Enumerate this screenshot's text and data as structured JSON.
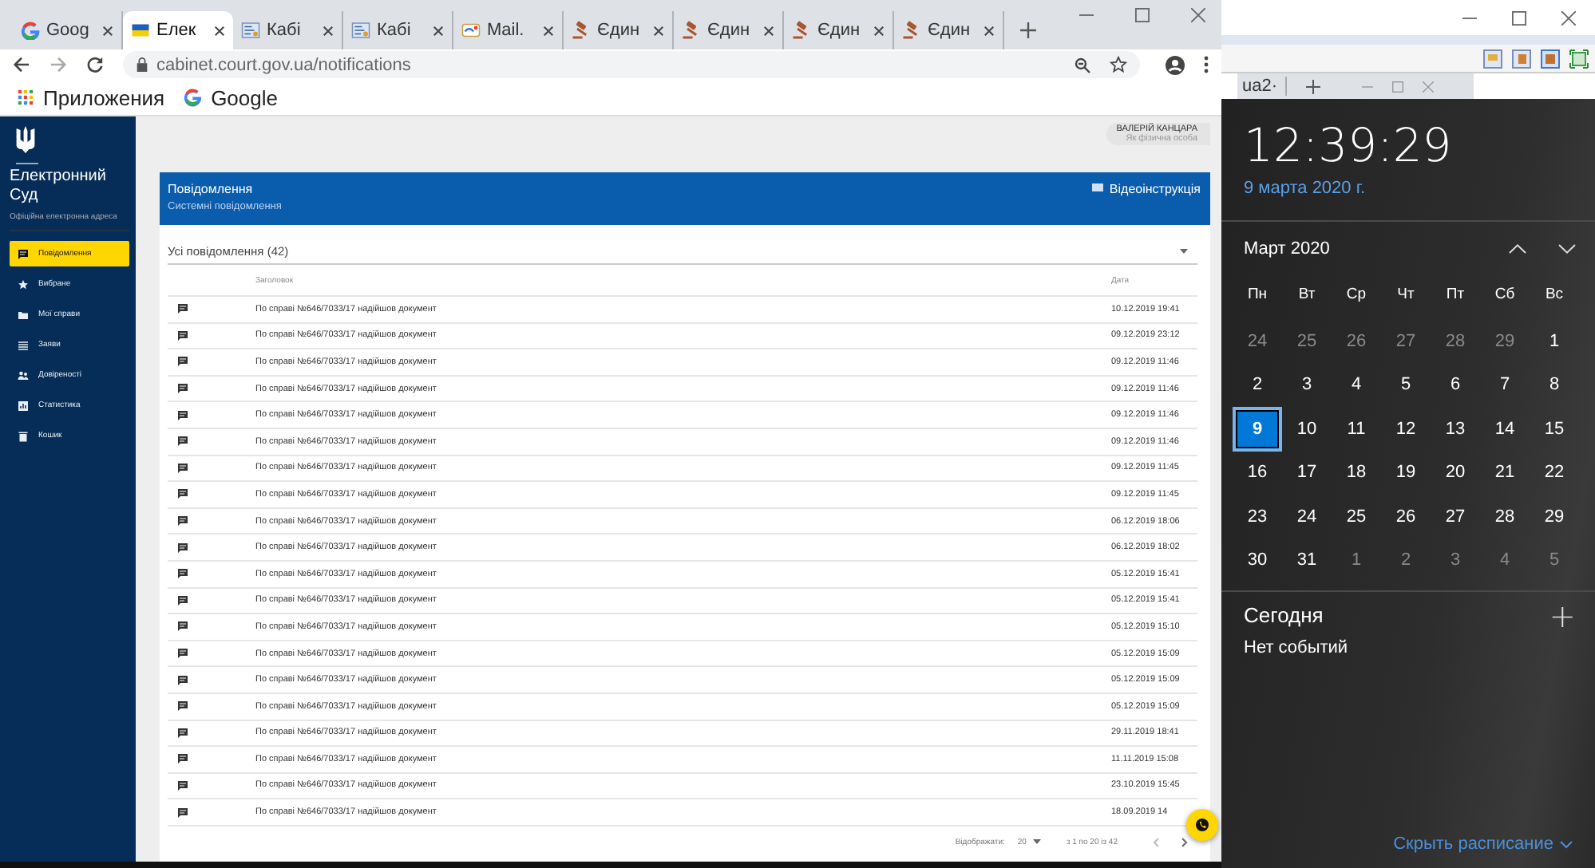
{
  "browser": {
    "tabs": [
      {
        "kind": "google",
        "label": "Goog",
        "selected": false
      },
      {
        "kind": "flag",
        "label": "Елек",
        "selected": true
      },
      {
        "kind": "cabinet",
        "label": "Кабі",
        "selected": false
      },
      {
        "kind": "cabinet",
        "label": "Кабі",
        "selected": false
      },
      {
        "kind": "mail",
        "label": "Mail.",
        "selected": false
      },
      {
        "kind": "gavel",
        "label": "Єдин",
        "selected": false
      },
      {
        "kind": "gavel",
        "label": "Єдин",
        "selected": false
      },
      {
        "kind": "gavel",
        "label": "Єдин",
        "selected": false
      },
      {
        "kind": "gavel",
        "label": "Єдин",
        "selected": false
      }
    ],
    "address": "cabinet.court.gov.ua/notifications",
    "bookmarks": [
      {
        "kind": "apps",
        "label": "Приложения"
      },
      {
        "kind": "google",
        "label": "Google"
      }
    ]
  },
  "app": {
    "brand": "Електронний Суд",
    "brand_subtitle": "Офіційна електронна адреса",
    "sidebar": [
      {
        "kind": "message",
        "label": "Повідомлення",
        "selected": true
      },
      {
        "kind": "star",
        "label": "Вибране",
        "selected": false
      },
      {
        "kind": "folder",
        "label": "Мої справи",
        "selected": false
      },
      {
        "kind": "list",
        "label": "Заяви",
        "selected": false
      },
      {
        "kind": "people",
        "label": "Довіреності",
        "selected": false
      },
      {
        "kind": "chart",
        "label": "Статистика",
        "selected": false
      },
      {
        "kind": "trash",
        "label": "Кошик",
        "selected": false
      }
    ],
    "user": {
      "name": "ВАЛЕРІЙ КАНЦАРА",
      "role": "Як фізична особа"
    },
    "header": {
      "title": "Повідомлення",
      "subtitle": "Системні повідомлення",
      "video_link": "Відеоінструкція"
    },
    "filter": "Усі повідомлення (42)",
    "columns": [
      "Заголовок",
      "Дата"
    ],
    "rows": [
      {
        "title": "По справі №646/7033/17 надійшов документ",
        "date": "10.12.2019 19:41"
      },
      {
        "title": "По справі №646/7033/17 надійшов документ",
        "date": "09.12.2019 23:12"
      },
      {
        "title": "По справі №646/7033/17 надійшов документ",
        "date": "09.12.2019 11:46"
      },
      {
        "title": "По справі №646/7033/17 надійшов документ",
        "date": "09.12.2019 11:46"
      },
      {
        "title": "По справі №646/7033/17 надійшов документ",
        "date": "09.12.2019 11:46"
      },
      {
        "title": "По справі №646/7033/17 надійшов документ",
        "date": "09.12.2019 11:46"
      },
      {
        "title": "По справі №646/7033/17 надійшов документ",
        "date": "09.12.2019 11:45"
      },
      {
        "title": "По справі №646/7033/17 надійшов документ",
        "date": "09.12.2019 11:45"
      },
      {
        "title": "По справі №646/7033/17 надійшов документ",
        "date": "06.12.2019 18:06"
      },
      {
        "title": "По справі №646/7033/17 надійшов документ",
        "date": "06.12.2019 18:02"
      },
      {
        "title": "По справі №646/7033/17 надійшов документ",
        "date": "05.12.2019 15:41"
      },
      {
        "title": "По справі №646/7033/17 надійшов документ",
        "date": "05.12.2019 15:41"
      },
      {
        "title": "По справі №646/7033/17 надійшов документ",
        "date": "05.12.2019 15:10"
      },
      {
        "title": "По справі №646/7033/17 надійшов документ",
        "date": "05.12.2019 15:09"
      },
      {
        "title": "По справі №646/7033/17 надійшов документ",
        "date": "05.12.2019 15:09"
      },
      {
        "title": "По справі №646/7033/17 надійшов документ",
        "date": "05.12.2019 15:09"
      },
      {
        "title": "По справі №646/7033/17 надійшов документ",
        "date": "29.11.2019 18:41"
      },
      {
        "title": "По справі №646/7033/17 надійшов документ",
        "date": "11.11.2019 15:08"
      },
      {
        "title": "По справі №646/7033/17 надійшов документ",
        "date": "23.10.2019 15:45"
      },
      {
        "title": "По справі №646/7033/17 надійшов документ",
        "date": "18.09.2019 14"
      }
    ],
    "pagination": {
      "label": "Відображати:",
      "page_size": "20",
      "range": "з 1 по 20 із 42"
    }
  },
  "back_window": {
    "tab_label": "ua2·"
  },
  "calendar": {
    "time": "12:39:29",
    "date": "9 марта 2020 г.",
    "month": "Март 2020",
    "weekdays": [
      "Пн",
      "Вт",
      "Ср",
      "Чт",
      "Пт",
      "Сб",
      "Вс"
    ],
    "days": [
      {
        "day": "24",
        "in_month": false,
        "selected": false
      },
      {
        "day": "25",
        "in_month": false,
        "selected": false
      },
      {
        "day": "26",
        "in_month": false,
        "selected": false
      },
      {
        "day": "27",
        "in_month": false,
        "selected": false
      },
      {
        "day": "28",
        "in_month": false,
        "selected": false
      },
      {
        "day": "29",
        "in_month": false,
        "selected": false
      },
      {
        "day": "1",
        "in_month": true,
        "selected": false
      },
      {
        "day": "2",
        "in_month": true,
        "selected": false
      },
      {
        "day": "3",
        "in_month": true,
        "selected": false
      },
      {
        "day": "4",
        "in_month": true,
        "selected": false
      },
      {
        "day": "5",
        "in_month": true,
        "selected": false
      },
      {
        "day": "6",
        "in_month": true,
        "selected": false
      },
      {
        "day": "7",
        "in_month": true,
        "selected": false
      },
      {
        "day": "8",
        "in_month": true,
        "selected": false
      },
      {
        "day": "9",
        "in_month": true,
        "selected": true
      },
      {
        "day": "10",
        "in_month": true,
        "selected": false
      },
      {
        "day": "11",
        "in_month": true,
        "selected": false
      },
      {
        "day": "12",
        "in_month": true,
        "selected": false
      },
      {
        "day": "13",
        "in_month": true,
        "selected": false
      },
      {
        "day": "14",
        "in_month": true,
        "selected": false
      },
      {
        "day": "15",
        "in_month": true,
        "selected": false
      },
      {
        "day": "16",
        "in_month": true,
        "selected": false
      },
      {
        "day": "17",
        "in_month": true,
        "selected": false
      },
      {
        "day": "18",
        "in_month": true,
        "selected": false
      },
      {
        "day": "19",
        "in_month": true,
        "selected": false
      },
      {
        "day": "20",
        "in_month": true,
        "selected": false
      },
      {
        "day": "21",
        "in_month": true,
        "selected": false
      },
      {
        "day": "22",
        "in_month": true,
        "selected": false
      },
      {
        "day": "23",
        "in_month": true,
        "selected": false
      },
      {
        "day": "24",
        "in_month": true,
        "selected": false
      },
      {
        "day": "25",
        "in_month": true,
        "selected": false
      },
      {
        "day": "26",
        "in_month": true,
        "selected": false
      },
      {
        "day": "27",
        "in_month": true,
        "selected": false
      },
      {
        "day": "28",
        "in_month": true,
        "selected": false
      },
      {
        "day": "29",
        "in_month": true,
        "selected": false
      },
      {
        "day": "30",
        "in_month": true,
        "selected": false
      },
      {
        "day": "31",
        "in_month": true,
        "selected": false
      },
      {
        "day": "1",
        "in_month": false,
        "selected": false
      },
      {
        "day": "2",
        "in_month": false,
        "selected": false
      },
      {
        "day": "3",
        "in_month": false,
        "selected": false
      },
      {
        "day": "4",
        "in_month": false,
        "selected": false
      },
      {
        "day": "5",
        "in_month": false,
        "selected": false
      }
    ],
    "today_title": "Сегодня",
    "add": "+",
    "events": "Нет событий",
    "hide_link": "Скрыть расписание"
  }
}
